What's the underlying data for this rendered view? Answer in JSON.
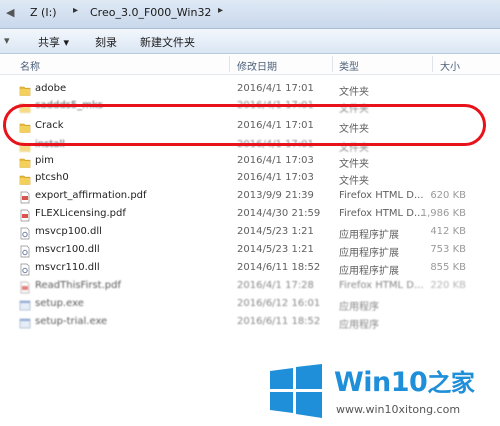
{
  "address": {
    "back_glyph": "◀",
    "segments": [
      "Z (I:)",
      "Creo_3.0_F000_Win32"
    ],
    "chevron": "▸"
  },
  "toolbar": {
    "organize_glyph": "▾",
    "share_label": "共享 ▾",
    "burn_label": "刻录",
    "new_folder_label": "新建文件夹"
  },
  "columns": {
    "name": "名称",
    "modified": "修改日期",
    "type": "类型",
    "size": "大小"
  },
  "files": [
    {
      "name": "adobe",
      "date": "2016/4/1 17:01",
      "type": "文件夹",
      "size": "",
      "icon": "folder-icon"
    },
    {
      "name": "caddds5_mks",
      "date": "2016/4/1 17:01",
      "type": "文件夹",
      "size": "",
      "icon": "folder-icon"
    },
    {
      "name": "Crack",
      "date": "2016/4/1 17:01",
      "type": "文件夹",
      "size": "",
      "icon": "folder-icon"
    },
    {
      "name": "install",
      "date": "2016/4/1 17:01",
      "type": "文件夹",
      "size": "",
      "icon": "folder-icon"
    },
    {
      "name": "pim",
      "date": "2016/4/1 17:03",
      "type": "文件夹",
      "size": "",
      "icon": "folder-icon"
    },
    {
      "name": "ptcsh0",
      "date": "2016/4/1 17:03",
      "type": "文件夹",
      "size": "",
      "icon": "folder-icon"
    },
    {
      "name": "export_affirmation.pdf",
      "date": "2013/9/9 21:39",
      "type": "Firefox HTML D...",
      "size": "620 KB",
      "icon": "pdf-icon"
    },
    {
      "name": "FLEXLicensing.pdf",
      "date": "2014/4/30 21:59",
      "type": "Firefox HTML D...",
      "size": "1,986 KB",
      "icon": "pdf-icon"
    },
    {
      "name": "msvcp100.dll",
      "date": "2014/5/23 1:21",
      "type": "应用程序扩展",
      "size": "412 KB",
      "icon": "dll-icon"
    },
    {
      "name": "msvcr100.dll",
      "date": "2014/5/23 1:21",
      "type": "应用程序扩展",
      "size": "753 KB",
      "icon": "dll-icon"
    },
    {
      "name": "msvcr110.dll",
      "date": "2014/6/11 18:52",
      "type": "应用程序扩展",
      "size": "855 KB",
      "icon": "dll-icon"
    },
    {
      "name": "ReadThisFirst.pdf",
      "date": "2016/4/1 17:28",
      "type": "Firefox HTML D...",
      "size": "220 KB",
      "icon": "pdf-icon"
    },
    {
      "name": "setup.exe",
      "date": "2016/6/12 16:01",
      "type": "应用程序",
      "size": "",
      "icon": "exe-icon"
    },
    {
      "name": "setup-trial.exe",
      "date": "2016/6/11 18:52",
      "type": "应用程序",
      "size": "",
      "icon": "exe-icon"
    }
  ],
  "watermark": {
    "brand": "Win10",
    "brand_suffix": "之家",
    "url": "www.win10xitong.com"
  },
  "colors": {
    "highlight": "#e8121a",
    "folder": "#e8b93a",
    "brand": "#1e8fd8"
  }
}
